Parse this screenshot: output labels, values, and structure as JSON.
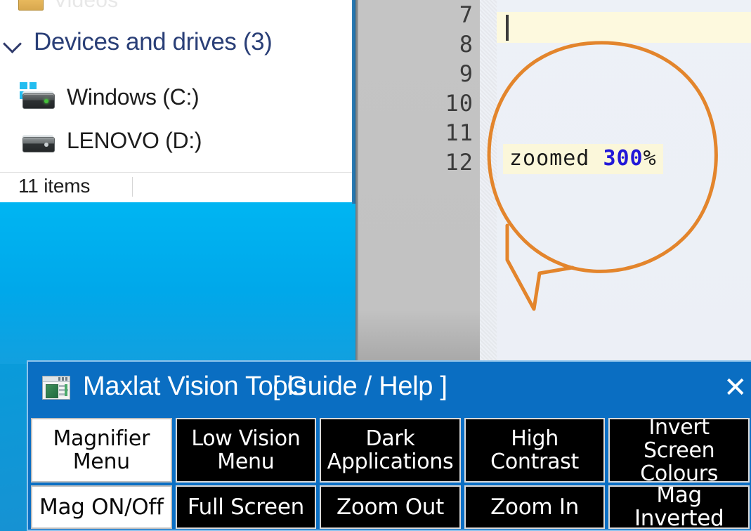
{
  "desktop": {
    "background_color": "#00a8ea"
  },
  "explorer": {
    "partial_top_item": "Videos",
    "group_header": "Devices and drives (3)",
    "chevron_icon": "chevron-down-icon",
    "drives": [
      {
        "label": "Windows (C:)",
        "icon": "hard-drive-windows-icon"
      },
      {
        "label": "LENOVO (D:)",
        "icon": "hard-drive-icon"
      }
    ],
    "status": "11 items"
  },
  "editor": {
    "line_numbers": [
      "7",
      "8",
      "9",
      "10",
      "11",
      "12"
    ],
    "current_line_caret": "|",
    "code_line": {
      "text": "zoomed 300%",
      "word": "zoomed ",
      "number": "300",
      "suffix": "%",
      "number_color": "#2218d8",
      "highlight_color": "#fbf7da"
    }
  },
  "callout": {
    "shape": "hand-drawn-speech-bubble",
    "color": "#e3852c",
    "annotates": "zoomed 300%"
  },
  "vision_tools": {
    "window_icon": "application-window-icon",
    "title": "Maxlat Vision Tools",
    "guide_help": "[ Guide / Help ]",
    "close_label": "✕",
    "titlebar_color": "#0a6ec2",
    "rows": [
      {
        "buttons": [
          {
            "label": "Magnifier\nMenu",
            "active": true
          },
          {
            "label": "Low Vision\nMenu",
            "active": false
          },
          {
            "label": "Dark\nApplications",
            "active": false
          },
          {
            "label": "High\nContrast",
            "active": false
          },
          {
            "label": "Invert Screen\nColours",
            "active": false
          }
        ]
      },
      {
        "buttons": [
          {
            "label": "Mag ON/Off",
            "active": true
          },
          {
            "label": "Full Screen",
            "active": false
          },
          {
            "label": "Zoom Out",
            "active": false
          },
          {
            "label": "Zoom In",
            "active": false
          },
          {
            "label": "Mag Inverted",
            "active": false
          }
        ]
      }
    ]
  }
}
